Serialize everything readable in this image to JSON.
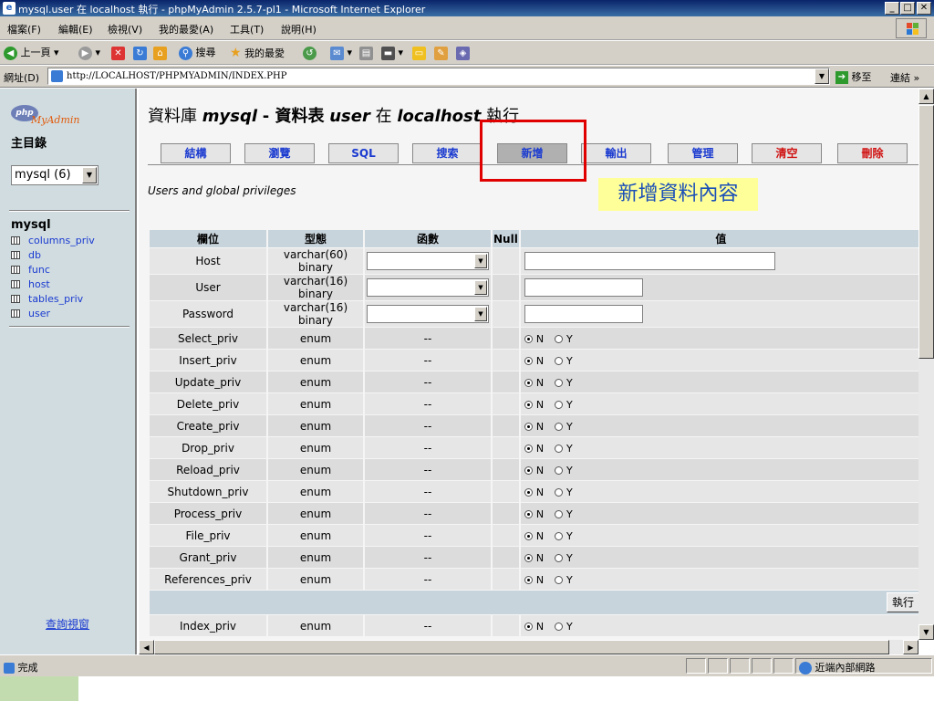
{
  "window": {
    "title": "mysql.user 在 localhost 執行 - phpMyAdmin 2.5.7-pl1 - Microsoft Internet Explorer",
    "min": "_",
    "max": "□",
    "close": "✕"
  },
  "menu": [
    "檔案(F)",
    "編輯(E)",
    "檢視(V)",
    "我的最愛(A)",
    "工具(T)",
    "說明(H)"
  ],
  "toolbar": {
    "back": "上一頁",
    "search": "搜尋",
    "favorites": "我的最愛"
  },
  "address": {
    "label": "網址(D)",
    "url": "http://LOCALHOST/PHPMYADMIN/INDEX.PHP",
    "go": "移至",
    "links": "連結 »"
  },
  "sidebar": {
    "logo_php": "php",
    "logo_myadmin": "MyAdmin",
    "home": "主目錄",
    "db_select": "mysql (6)",
    "db_name": "mysql",
    "tables": [
      "columns_priv",
      "db",
      "func",
      "host",
      "tables_priv",
      "user"
    ],
    "query_window": "查詢視窗"
  },
  "main": {
    "heading_prefix": "資料庫",
    "heading_db": "mysql",
    "heading_mid": "- 資料表",
    "heading_table": "user",
    "heading_at": "在",
    "heading_host": "localhost",
    "heading_suffix": "執行",
    "tabs": [
      "結構",
      "瀏覽",
      "SQL",
      "搜索",
      "新增",
      "輸出",
      "管理",
      "清空",
      "刪除"
    ],
    "active_tab": "新增",
    "annotation": "新增資料內容",
    "description": "Users and global privileges"
  },
  "table": {
    "headers": [
      "欄位",
      "型態",
      "函數",
      "Null",
      "值"
    ],
    "text_rows": [
      {
        "field": "Host",
        "type": "varchar(60) binary"
      },
      {
        "field": "User",
        "type": "varchar(16) binary"
      },
      {
        "field": "Password",
        "type": "varchar(16) binary"
      }
    ],
    "enum_rows": [
      "Select_priv",
      "Insert_priv",
      "Update_priv",
      "Delete_priv",
      "Create_priv",
      "Drop_priv",
      "Reload_priv",
      "Shutdown_priv",
      "Process_priv",
      "File_priv",
      "Grant_priv",
      "References_priv"
    ],
    "enum_type": "enum",
    "func_placeholder": "--",
    "radio_n": "N",
    "radio_y": "Y",
    "submit": "執行",
    "after_row": "Index_priv"
  },
  "status": {
    "text": "完成",
    "zone": "近端內部網路"
  }
}
